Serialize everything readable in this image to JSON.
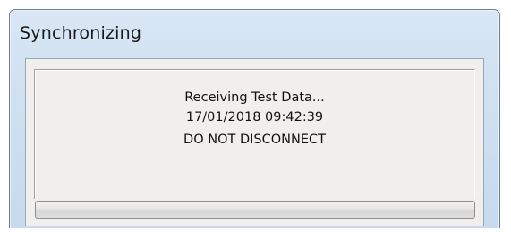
{
  "window": {
    "title": "Synchronizing"
  },
  "message": {
    "status": "Receiving Test Data...",
    "timestamp": "17/01/2018 09:42:39",
    "warning": "DO NOT DISCONNECT"
  },
  "progress": {
    "fraction": 0.0
  }
}
